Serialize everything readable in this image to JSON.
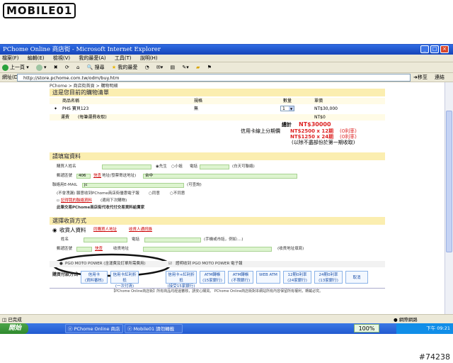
{
  "logo": "MOBILE01",
  "window": {
    "title": "PChome Online 商店街 - Microsoft Internet Explorer",
    "menu": [
      "檔案(F)",
      "編輯(E)",
      "檢視(V)",
      "我的最愛(A)",
      "工具(T)",
      "說明(H)"
    ],
    "toolbar": {
      "back": "上一頁",
      "search": "搜尋",
      "favorites": "我的最愛"
    },
    "address_label": "網址(D)",
    "address": "http://store.pchome.com.tw/odm/buy.htm",
    "go": "移至",
    "links": "連結"
  },
  "page": {
    "breadcrumb": "PChome > 商店街首頁 > 購物明細",
    "cart": {
      "title": "這是您目前的購物清單",
      "headers": [
        "商品名稱",
        "規格",
        "數量",
        "單價"
      ],
      "item": {
        "name": "PHS 寶貝123",
        "spec": "無",
        "qty": "1",
        "price": "NT$30,000"
      },
      "shipping_label": "運費",
      "shipping_note": "(每筆運費收取)",
      "shipping_value": "NT$0",
      "total_label": "總計",
      "total_value": "NT$30000",
      "installment_label": "信用卡線上分期價",
      "inst1": "NT$2500 x 12期",
      "inst1_note": "(0利率)",
      "inst2": "NT$1250 x 24期",
      "inst2_note": "(0利率)",
      "installment_note": "(以除不盡部份於第一期收取)"
    },
    "buyer": {
      "title": "請填寫資料",
      "name_label": "購買人姓名",
      "male": "先生",
      "female": "小姐",
      "phone_label": "電話",
      "phone_note": "(白天可聯絡)",
      "zip_label": "郵遞區號",
      "zip_value": "406",
      "zip_link": "快查",
      "address_label": "地址(發票寄送地址)",
      "address_value": "台中",
      "email_label": "聯絡用E-MAIL",
      "email_value": "jc",
      "email_note": "(可查詢)",
      "newsletter": "(不會洩漏) 願意收到PChome商店街優惠電子報",
      "agree": "同意",
      "disagree": "不同意",
      "remember_link": "記得我的聯絡資料",
      "remember_note": "(適用下次購物)",
      "disclaimer": "此筆交易PChome商店街代收代付交易資料給賣家"
    },
    "payment": {
      "title": "選擇收貨方式",
      "recipient_title": "收貨人資料",
      "same_as_buyer": "同購買人地址",
      "choose_saved": "收貨人通訊錄",
      "name_label": "姓名",
      "phone_label": "電話",
      "phone_note": "(手機或市話，例如:...)",
      "zip_label": "郵遞區號",
      "zip_link": "快查",
      "addr_label": "收貨地址",
      "addr_note": "(收貨地址填寫)",
      "opt1": "PGO MOTO POWER (含運費及訂單所需費用)",
      "opt2": "證明收到 PGO MOTO POWER 電子報",
      "pay_label": "購買付款方式",
      "methods": [
        {
          "l1": "信用卡",
          "l2": "(資料審核)"
        },
        {
          "l1": "信用卡紅利折抵",
          "l2": "(一次付清)"
        },
        {
          "l1": "信用卡+紅利折抵",
          "l2": "(接受15家銀行)"
        },
        {
          "l1": "ATM轉帳",
          "l2": "(15家銀行)"
        },
        {
          "l1": "ATM轉帳",
          "l2": "(不限銀行)"
        },
        {
          "l1": "WEB ATM",
          "l2": ""
        },
        {
          "l1": "12期0利率",
          "l2": "(24家銀行)"
        },
        {
          "l1": "24期0利率",
          "l2": "(13家銀行)"
        },
        {
          "l1": "取消",
          "l2": ""
        }
      ],
      "footer": "【PChome Online商店街】所有商品均經過審核，請安心購買。 PChome Online商店街對本網站所有內容保留所有權利，轉載必究。"
    }
  },
  "status": {
    "left": "已完成",
    "zone": "網際網路"
  },
  "taskbar": {
    "start": "開始",
    "tasks": [
      "PChome Online 商店",
      "Mobile01 請勿轉載的..."
    ],
    "zoom": "100%",
    "clock": "下午 09:21"
  },
  "stamp": "#74238",
  "colors": {
    "title_bar": "#1f55cf",
    "section_header": "#fbeeb0",
    "price_red": "#d22222",
    "field_green": "#ddf4cf"
  }
}
